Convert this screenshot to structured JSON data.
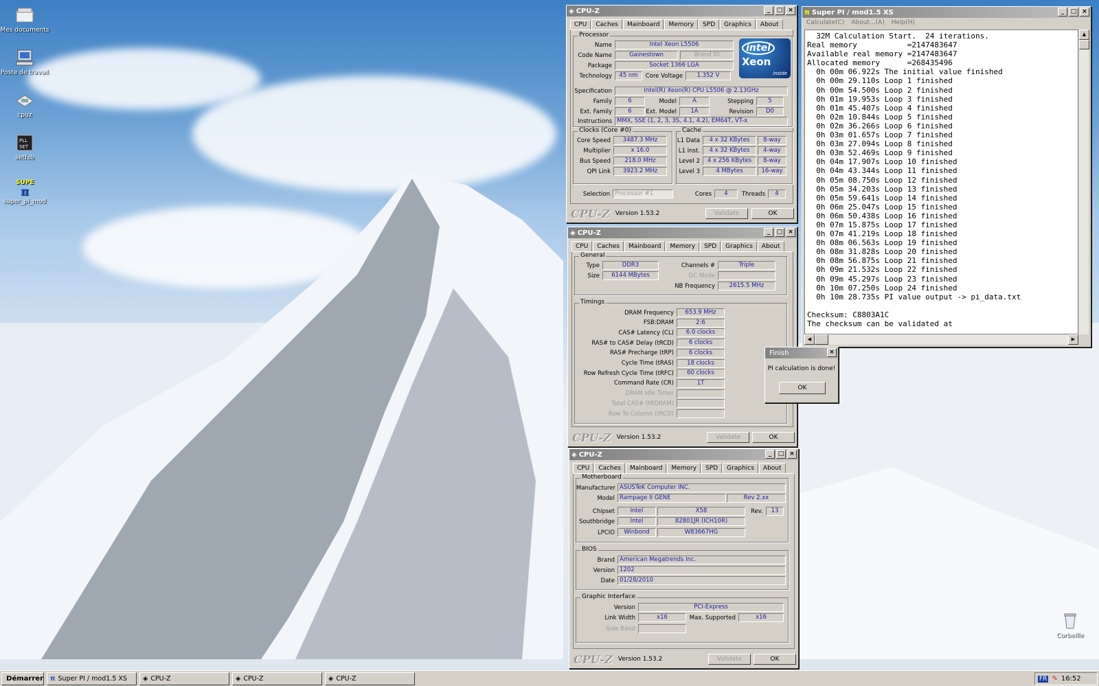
{
  "desktop": {
    "icons": [
      {
        "label": "Mes documents",
        "icon": "documents-folder-icon"
      },
      {
        "label": "Poste de travail",
        "icon": "my-computer-icon"
      },
      {
        "label": "cpuz",
        "icon": "cpuz-app-icon"
      },
      {
        "label": "setfsb",
        "icon": "setfsb-app-icon"
      },
      {
        "label": "super_pi_mod",
        "icon": "superpi-app-icon"
      }
    ],
    "recycle_bin": "Corbeille"
  },
  "cpuz_cpu": {
    "title": "CPU-Z",
    "tabs": [
      "CPU",
      "Caches",
      "Mainboard",
      "Memory",
      "SPD",
      "Graphics",
      "About"
    ],
    "active_tab": "CPU",
    "processor_group": "Processor",
    "name_label": "Name",
    "name": "Intel Xeon L5506",
    "codename_label": "Code Name",
    "codename": "Gainestown",
    "brand_id_label": "Brand ID",
    "package_label": "Package",
    "package": "Socket 1366 LGA",
    "technology_label": "Technology",
    "technology": "45 nm",
    "core_voltage_label": "Core Voltage",
    "core_voltage": "1.352 V",
    "spec_label": "Specification",
    "spec": "Intel(R) Xeon(R) CPU        L5506  @ 2.13GHz",
    "family_label": "Family",
    "family": "6",
    "model_label": "Model",
    "model": "A",
    "stepping_label": "Stepping",
    "stepping": "5",
    "ext_family_label": "Ext. Family",
    "ext_family": "6",
    "ext_model_label": "Ext. Model",
    "ext_model": "1A",
    "revision_label": "Revision",
    "revision": "D0",
    "instructions_label": "Instructions",
    "instructions": "MMX, SSE (1, 2, 3, 3S, 4.1, 4.2), EM64T, VT-x",
    "logo": {
      "brand": "intel",
      "product": "Xeon",
      "tag": "inside"
    },
    "clocks_group": "Clocks (Core #0)",
    "core_speed_label": "Core Speed",
    "core_speed": "3487.3 MHz",
    "multiplier_label": "Multiplier",
    "multiplier": "x 16.0",
    "bus_speed_label": "Bus Speed",
    "bus_speed": "218.0 MHz",
    "qpi_label": "QPI Link",
    "qpi": "3923.2 MHz",
    "cache_group": "Cache",
    "cache_rows": [
      {
        "label": "L1 Data",
        "size": "4 x 32 KBytes",
        "way": "8-way"
      },
      {
        "label": "L1 Inst.",
        "size": "4 x 32 KBytes",
        "way": "4-way"
      },
      {
        "label": "Level 2",
        "size": "4 x 256 KBytes",
        "way": "8-way"
      },
      {
        "label": "Level 3",
        "size": "4 MBytes",
        "way": "16-way"
      }
    ],
    "selection_label": "Selection",
    "selection": "Processor #1",
    "cores_label": "Cores",
    "cores": "4",
    "threads_label": "Threads",
    "threads": "4",
    "logo_text": "CPU-Z",
    "version": "Version 1.53.2",
    "validate": "Validate",
    "ok": "OK"
  },
  "cpuz_mem": {
    "title": "CPU-Z",
    "tabs": [
      "CPU",
      "Caches",
      "Mainboard",
      "Memory",
      "SPD",
      "Graphics",
      "About"
    ],
    "active_tab": "Memory",
    "general_group": "General",
    "type_label": "Type",
    "type": "DDR3",
    "size_label": "Size",
    "size": "6144 MBytes",
    "channels_label": "Channels #",
    "channels": "Triple",
    "dc_mode_label": "DC Mode",
    "nb_freq_label": "NB Frequency",
    "nb_freq": "2615.5 MHz",
    "timings_group": "Timings",
    "timings": [
      {
        "label": "DRAM Frequency",
        "value": "653.9 MHz"
      },
      {
        "label": "FSB:DRAM",
        "value": "2:6"
      },
      {
        "label": "CAS# Latency (CL)",
        "value": "6.0 clocks"
      },
      {
        "label": "RAS# to CAS# Delay (tRCD)",
        "value": "6 clocks"
      },
      {
        "label": "RAS# Precharge (tRP)",
        "value": "6 clocks"
      },
      {
        "label": "Cycle Time (tRAS)",
        "value": "18 clocks"
      },
      {
        "label": "Row Refresh Cycle Time (tRFC)",
        "value": "60 clocks"
      },
      {
        "label": "Command Rate (CR)",
        "value": "1T"
      },
      {
        "label": "DRAM Idle Timer",
        "value": ""
      },
      {
        "label": "Total CAS# (tRDRAM)",
        "value": ""
      },
      {
        "label": "Row To Column (tRCD)",
        "value": ""
      }
    ],
    "logo_text": "CPU-Z",
    "version": "Version 1.53.2",
    "validate": "Validate",
    "ok": "OK"
  },
  "cpuz_mb": {
    "title": "CPU-Z",
    "tabs": [
      "CPU",
      "Caches",
      "Mainboard",
      "Memory",
      "SPD",
      "Graphics",
      "About"
    ],
    "active_tab": "Mainboard",
    "mb_group": "Motherboard",
    "manufacturer_label": "Manufacturer",
    "manufacturer": "ASUSTeK Computer INC.",
    "model_label": "Model",
    "model": "Rampage II GENE",
    "model_rev": "Rev 2.xx",
    "chipset_label": "Chipset",
    "chipset_vendor": "Intel",
    "chipset": "X58",
    "rev_label": "Rev.",
    "chipset_rev": "13",
    "southbridge_label": "Southbridge",
    "sb_vendor": "Intel",
    "southbridge": "82801JR (ICH10R)",
    "lpcio_label": "LPCIO",
    "lpcio_vendor": "Winbond",
    "lpcio": "W83667HG",
    "bios_group": "BIOS",
    "brand_label": "Brand",
    "brand": "American Megatrends Inc.",
    "version_label": "Version",
    "bios_version": "1202",
    "date_label": "Date",
    "date": "01/28/2010",
    "gi_group": "Graphic Interface",
    "gi_version_label": "Version",
    "gi_version": "PCI-Express",
    "link_width_label": "Link Width",
    "link_width": "x16",
    "max_supported_label": "Max. Supported",
    "max_supported": "x16",
    "side_band_label": "Side Band",
    "logo_text": "CPU-Z",
    "version": "Version 1.53.2",
    "validate": "Validate",
    "ok": "OK"
  },
  "superpi": {
    "title": "Super PI / mod1.5 XS",
    "menu": [
      "Calculate(C)",
      "About...(A)",
      "Help(H)"
    ],
    "lines": [
      "  32M Calculation Start.  24 iterations.",
      "Real memory           =2147483647",
      "Available real memory =2147483647",
      "Allocated memory      =268435496",
      "  0h 00m 06.922s The initial value finished",
      "  0h 00m 29.110s Loop 1 finished",
      "  0h 00m 54.500s Loop 2 finished",
      "  0h 01m 19.953s Loop 3 finished",
      "  0h 01m 45.407s Loop 4 finished",
      "  0h 02m 10.844s Loop 5 finished",
      "  0h 02m 36.266s Loop 6 finished",
      "  0h 03m 01.657s Loop 7 finished",
      "  0h 03m 27.094s Loop 8 finished",
      "  0h 03m 52.469s Loop 9 finished",
      "  0h 04m 17.907s Loop 10 finished",
      "  0h 04m 43.344s Loop 11 finished",
      "  0h 05m 08.750s Loop 12 finished",
      "  0h 05m 34.203s Loop 13 finished",
      "  0h 05m 59.641s Loop 14 finished",
      "  0h 06m 25.047s Loop 15 finished",
      "  0h 06m 50.438s Loop 16 finished",
      "  0h 07m 15.875s Loop 17 finished",
      "  0h 07m 41.219s Loop 18 finished",
      "  0h 08m 06.563s Loop 19 finished",
      "  0h 08m 31.828s Loop 20 finished",
      "  0h 08m 56.875s Loop 21 finished",
      "  0h 09m 21.532s Loop 22 finished",
      "  0h 09m 45.297s Loop 23 finished",
      "  0h 10m 07.250s Loop 24 finished",
      "  0h 10m 28.735s PI value output -> pi_data.txt",
      "",
      "Checksum: C8803A1C",
      "The checksum can be validated at"
    ]
  },
  "finish": {
    "title": "Finish",
    "message": "PI calculation is done!",
    "ok": "OK"
  },
  "taskbar": {
    "start": "Démarrer",
    "tasks": [
      {
        "label": "Super PI / mod1.5 XS",
        "icon": "superpi-task-icon"
      },
      {
        "label": "CPU-Z",
        "icon": "cpuz-task-icon"
      },
      {
        "label": "CPU-Z",
        "icon": "cpuz-task-icon"
      },
      {
        "label": "CPU-Z",
        "icon": "cpuz-task-icon"
      }
    ],
    "lang": "FR",
    "clock": "16:52"
  }
}
